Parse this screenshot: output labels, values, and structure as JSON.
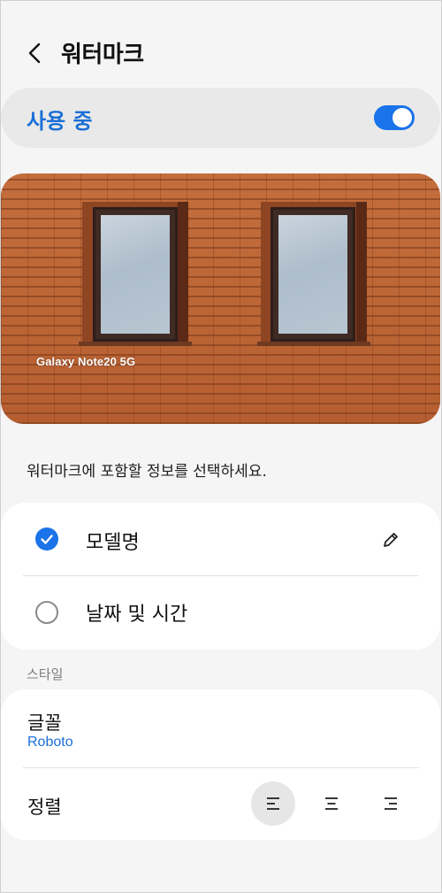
{
  "header": {
    "title": "워터마크",
    "back_icon": "chevron-left-icon"
  },
  "master_switch": {
    "label": "사용 중",
    "enabled": true,
    "accent_color": "#1a73e8"
  },
  "preview": {
    "watermark_text": "Galaxy Note20 5G"
  },
  "instruction": "워터마크에 포함할 정보를 선택하세요.",
  "options": [
    {
      "label": "모델명",
      "selected": true,
      "edit_icon": "pencil-icon"
    },
    {
      "label": "날짜 및 시간",
      "selected": false
    }
  ],
  "style_section": {
    "header": "스타일",
    "font": {
      "label": "글꼴",
      "value": "Roboto"
    },
    "alignment": {
      "label": "정렬",
      "options": [
        {
          "name": "align-left-icon",
          "active": true
        },
        {
          "name": "align-center-icon",
          "active": false
        },
        {
          "name": "align-right-icon",
          "active": false
        }
      ]
    }
  }
}
